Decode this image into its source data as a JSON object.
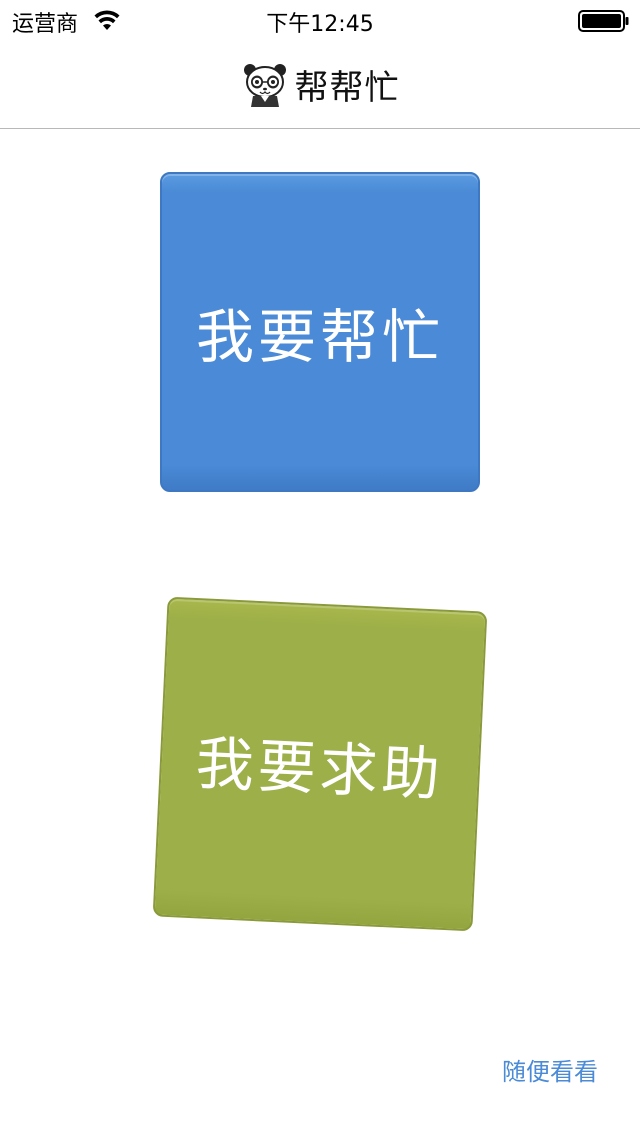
{
  "status_bar": {
    "carrier": "运营商",
    "time": "下午12:45"
  },
  "nav": {
    "title": "帮帮忙",
    "logo_icon": "panda-icon"
  },
  "tiles": {
    "help_label": "我要帮忙",
    "ask_label": "我要求助"
  },
  "browse": {
    "label": "随便看看"
  },
  "colors": {
    "help_tile": "#4a8ad6",
    "ask_tile": "#9daf48",
    "link": "#4a8ad6"
  }
}
